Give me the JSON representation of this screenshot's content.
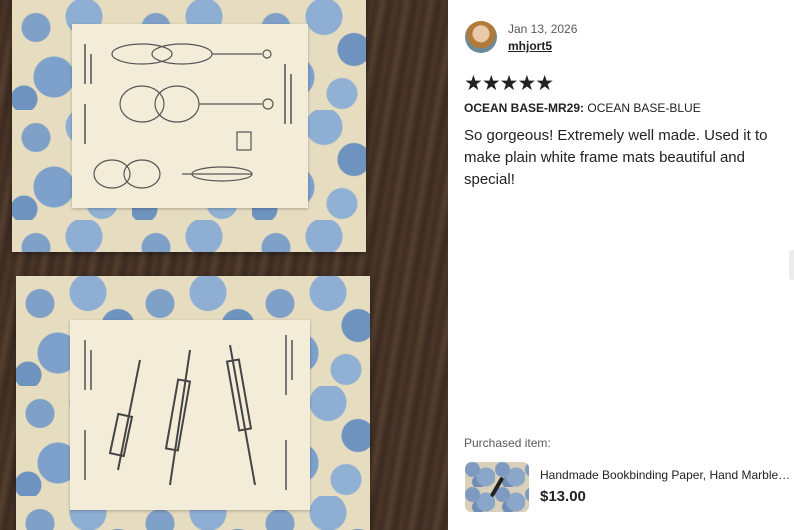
{
  "review": {
    "date": "Jan 13, 2026",
    "username": "mhjort5",
    "rating_stars": "★★★★★",
    "rating": 5,
    "variation_label": "OCEAN BASE-MR29:",
    "variation_value": "OCEAN BASE-BLUE",
    "text": "So gorgeous! Extremely well made. Used it to make plain white frame mats beautiful and special!"
  },
  "purchased": {
    "label": "Purchased item:",
    "title": "Handmade Bookbinding Paper, Hand Marbled...",
    "price": "$13.00"
  },
  "colors": {
    "marble_blue": "#7fa0c7",
    "marble_cream": "#e6dcc0",
    "wood": "#3f2e23"
  }
}
